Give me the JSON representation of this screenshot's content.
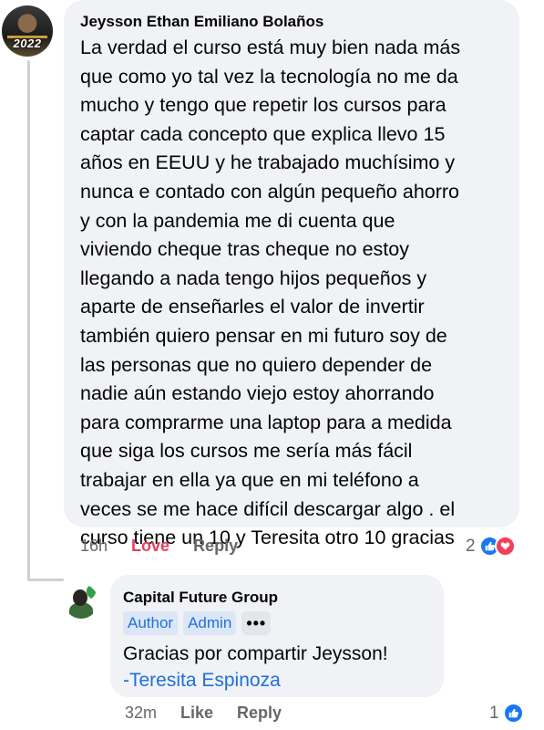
{
  "comment": {
    "author": "Jeysson Ethan Emiliano Bolaños",
    "avatar_text": "2022",
    "lines": [
      "La verdad el curso está muy bien nada más",
      "que como yo tal vez la tecnología no me da",
      "mucho y tengo que repetir los cursos para",
      "captar cada concepto que explica llevo 15",
      "años en EEUU y he trabajado muchísimo y",
      "nunca e contado con algún pequeño ahorro",
      "y con la pandemia me di cuenta que",
      "viviendo cheque tras cheque no estoy",
      "llegando a nada tengo hijos pequeños y",
      "aparte de enseñarles el valor de invertir",
      "también quiero pensar en mi futuro soy de",
      "las personas que no quiero depender de",
      "nadie aún estando viejo estoy ahorrando",
      "para comprarme una laptop para a medida",
      "que siga los cursos me sería más fácil",
      "trabajar en ella ya que en mi teléfono a",
      "veces se me hace difícil descargar algo . el",
      "curso tiene un 10 y Teresita otro 10 gracias"
    ],
    "time": "16h",
    "love_label": "Love",
    "reply_label": "Reply",
    "reaction_count": "2",
    "reaction_icons": [
      "like-icon",
      "love-icon"
    ]
  },
  "reply": {
    "author": "Capital Future Group",
    "badges": [
      "Author",
      "Admin"
    ],
    "more_label": "•••",
    "text": "Gracias por compartir Jeysson!",
    "signature": "-Teresita Espinoza",
    "time": "32m",
    "like_label": "Like",
    "reply_label": "Reply",
    "reaction_count": "1",
    "reaction_icons": [
      "like-icon"
    ]
  },
  "colors": {
    "bubble": "#f0f2f5",
    "link_blue": "#216fdb",
    "love_red": "#e4405f",
    "meta_gray": "#65676b"
  }
}
